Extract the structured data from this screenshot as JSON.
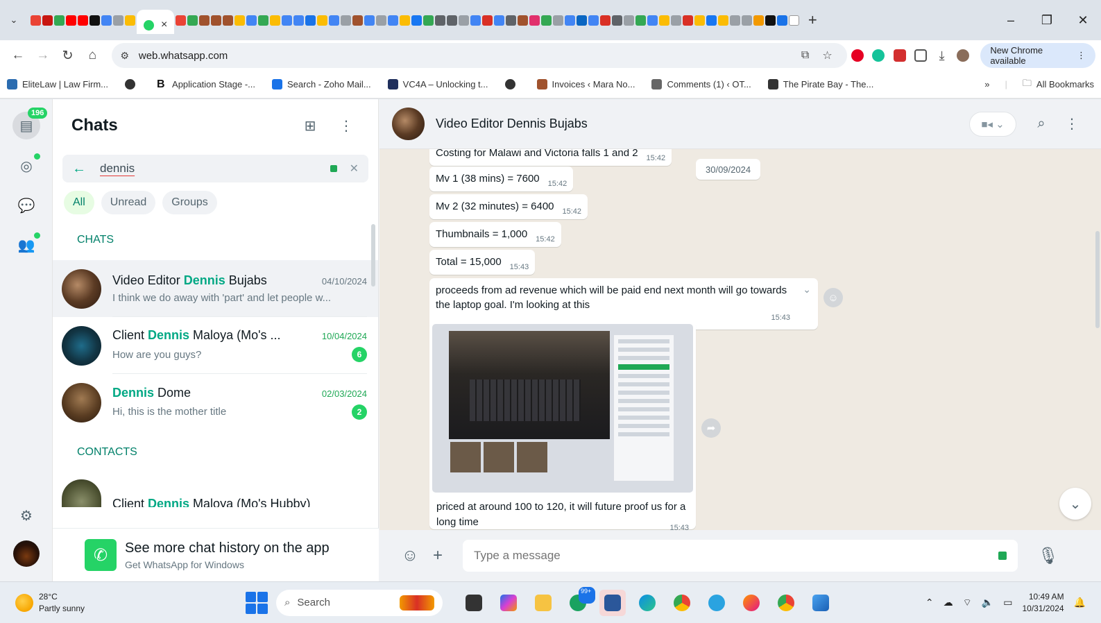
{
  "browser": {
    "tab_close": "×",
    "new_tab": "+",
    "url": "web.whatsapp.com",
    "update_label": "New Chrome available",
    "bookmarks": [
      {
        "label": "EliteLaw | Law Firm..."
      },
      {
        "label": ""
      },
      {
        "label": "Application Stage -..."
      },
      {
        "label": "Search - Zoho Mail..."
      },
      {
        "label": "VC4A – Unlocking t..."
      },
      {
        "label": ""
      },
      {
        "label": "Invoices ‹ Mara No..."
      },
      {
        "label": "Comments (1) ‹ OT..."
      },
      {
        "label": "The Pirate Bay - The..."
      }
    ],
    "overflow_label": "»",
    "all_bookmarks_label": "All Bookmarks"
  },
  "rail": {
    "chats_badge": "196"
  },
  "sidebar": {
    "title": "Chats",
    "search_query": "dennis",
    "filters": [
      "All",
      "Unread",
      "Groups"
    ],
    "chats_section": "CHATS",
    "contacts_section": "CONTACTS",
    "chats": [
      {
        "name_before": "Video Editor ",
        "name_match": "Dennis",
        "name_after": " Bujabs",
        "date": "04/10/2024",
        "preview": "I think we do away with 'part' and let people w...",
        "unread": ""
      },
      {
        "name_before": "Client ",
        "name_match": "Dennis",
        "name_after": " Maloya (Mo's ...",
        "date": "10/04/2024",
        "preview": "How are you guys?",
        "unread": "6"
      },
      {
        "name_before": "",
        "name_match": "Dennis",
        "name_after": " Dome",
        "date": "02/03/2024",
        "preview": "Hi, this is the mother title",
        "unread": "2"
      }
    ],
    "contacts": [
      {
        "name_before": "Client ",
        "name_match": "Dennis",
        "name_after": " Maloya (Mo's Hubby)"
      }
    ],
    "promo_title": "See more chat history on the app",
    "promo_sub": "Get WhatsApp for Windows"
  },
  "conversation": {
    "contact_name": "Video Editor Dennis Bujabs",
    "date_divider": "30/09/2024",
    "messages": [
      {
        "text": "Costing for Malawi and Victoria falls 1 and 2",
        "time": "15:42"
      },
      {
        "text": "Mv 1 (38 mins) = 7600",
        "time": "15:42"
      },
      {
        "text": "Mv 2 (32 minutes) = 6400",
        "time": "15:42"
      },
      {
        "text": "Thumbnails = 1,000",
        "time": "15:42"
      },
      {
        "text": "Total = 15,000",
        "time": "15:43"
      },
      {
        "text": "proceeds from ad revenue which will be paid end next month will go towards the laptop goal. I'm looking at this",
        "time": "15:43"
      }
    ],
    "image_caption": "priced at around 100 to 120, it will future proof us for a long time",
    "image_caption_time": "15:43",
    "composer_placeholder": "Type a message"
  },
  "taskbar": {
    "temperature": "28°C",
    "weather": "Partly sunny",
    "search_label": "Search",
    "chat_badge": "99+",
    "time": "10:49 AM",
    "date": "10/31/2024"
  }
}
